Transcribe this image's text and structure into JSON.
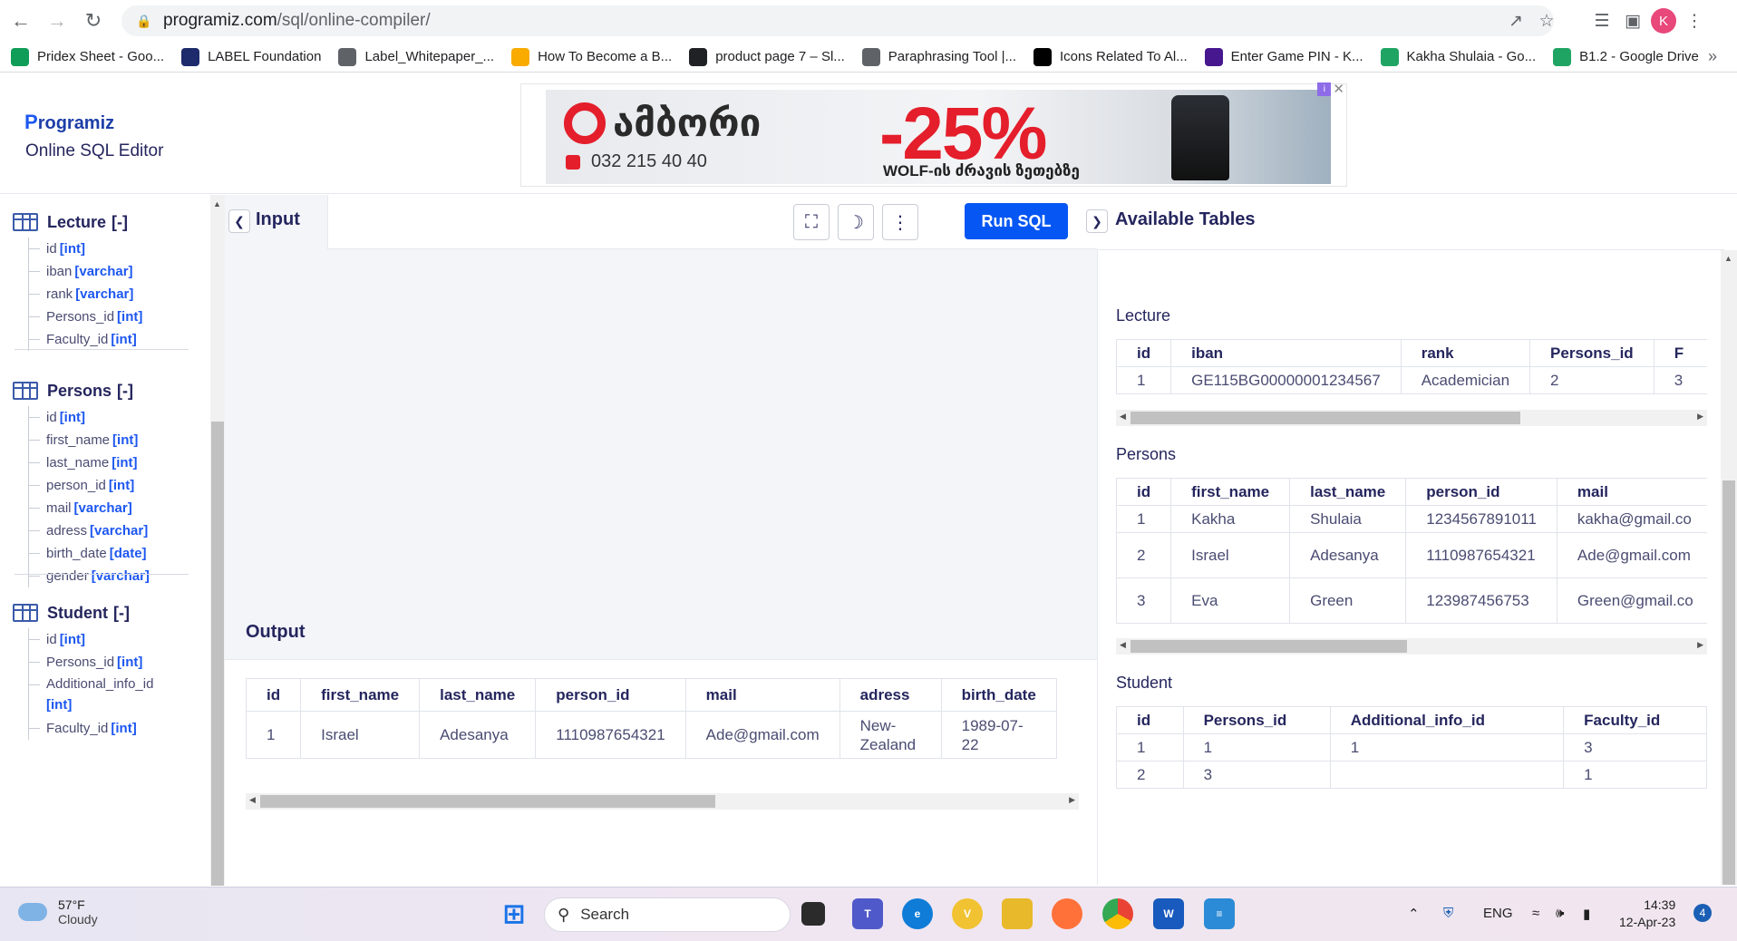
{
  "browser": {
    "url_host": "programiz.com",
    "url_path": "/sql/online-compiler/",
    "profile_initial": "K"
  },
  "bookmarks": [
    {
      "label": "Pridex Sheet - Goo...",
      "icon": "sheets-icon",
      "color": "#0f9d58"
    },
    {
      "label": "LABEL Foundation",
      "icon": "label-icon",
      "color": "#1d2a6b"
    },
    {
      "label": "Label_Whitepaper_...",
      "icon": "globe-icon",
      "color": "#5f6368"
    },
    {
      "label": "How To Become a B...",
      "icon": "bar-icon",
      "color": "#f9ab00"
    },
    {
      "label": "product page 7 – Sl...",
      "icon": "s-icon",
      "color": "#202124"
    },
    {
      "label": "Paraphrasing Tool |...",
      "icon": "pen-icon",
      "color": "#5f6368"
    },
    {
      "label": "Icons Related To Al...",
      "icon": "dots-icon",
      "color": "#000000"
    },
    {
      "label": "Enter Game PIN - K...",
      "icon": "kahoot-icon",
      "color": "#46178f"
    },
    {
      "label": "Kakha Shulaia - Go...",
      "icon": "drive-icon",
      "color": "#1fa463"
    },
    {
      "label": "B1.2 - Google Drive",
      "icon": "drive-icon",
      "color": "#1fa463"
    }
  ],
  "header": {
    "logo": "rogramiz",
    "logo_p": "P",
    "subtitle": "Online SQL Editor"
  },
  "ad": {
    "brand": "ამბორი",
    "phone": "032 215 40 40",
    "discount": "-25%",
    "tagline": "WOLF-ის ძრავის ზეთებზე"
  },
  "sidebar": {
    "tables": [
      {
        "name": "Lecture",
        "toggle": "[-]",
        "columns": [
          {
            "name": "id",
            "type": "[int]"
          },
          {
            "name": "iban",
            "type": "[varchar]"
          },
          {
            "name": "rank",
            "type": "[varchar]"
          },
          {
            "name": "Persons_id",
            "type": "[int]"
          },
          {
            "name": "Faculty_id",
            "type": "[int]"
          }
        ]
      },
      {
        "name": "Persons",
        "toggle": "[-]",
        "columns": [
          {
            "name": "id",
            "type": "[int]"
          },
          {
            "name": "first_name",
            "type": "[int]"
          },
          {
            "name": "last_name",
            "type": "[int]"
          },
          {
            "name": "person_id",
            "type": "[int]"
          },
          {
            "name": "mail",
            "type": "[varchar]"
          },
          {
            "name": "adress",
            "type": "[varchar]"
          },
          {
            "name": "birth_date",
            "type": "[date]"
          },
          {
            "name": "gender",
            "type": "[varchar]"
          }
        ]
      },
      {
        "name": "Student",
        "toggle": "[-]",
        "columns": [
          {
            "name": "id",
            "type": "[int]"
          },
          {
            "name": "Persons_id",
            "type": "[int]"
          },
          {
            "name": "Additional_info_id",
            "type": "[int]"
          },
          {
            "name": "Faculty_id",
            "type": "[int]"
          }
        ]
      }
    ]
  },
  "editor": {
    "tab_label": "Input",
    "run_label": "Run SQL"
  },
  "output": {
    "label": "Output",
    "headers": [
      "id",
      "first_name",
      "last_name",
      "person_id",
      "mail",
      "adress",
      "birth_date"
    ],
    "rows": [
      [
        "1",
        "Israel",
        "Adesanya",
        "1110987654321",
        "Ade@gmail.com",
        "New-\nZealand",
        "1989-07-\n22"
      ]
    ]
  },
  "available": {
    "title": "Available Tables",
    "tables": [
      {
        "name": "Lecture",
        "headers": [
          "id",
          "iban",
          "rank",
          "Persons_id",
          "F"
        ],
        "rows": [
          [
            "1",
            "GE115BG00000001234567",
            "Academician",
            "2",
            "3"
          ]
        ]
      },
      {
        "name": "Persons",
        "headers": [
          "id",
          "first_name",
          "last_name",
          "person_id",
          "mail"
        ],
        "rows": [
          [
            "1",
            "Kakha",
            "Shulaia",
            "1234567891011",
            "kakha@gmail.co"
          ],
          [
            "2",
            "Israel",
            "Adesanya",
            "1110987654321",
            "Ade@gmail.com"
          ],
          [
            "3",
            "Eva",
            "Green",
            "123987456753",
            "Green@gmail.co"
          ]
        ]
      },
      {
        "name": "Student",
        "headers": [
          "id",
          "Persons_id",
          "Additional_info_id",
          "Faculty_id"
        ],
        "rows": [
          [
            "1",
            "1",
            "1",
            "3"
          ],
          [
            "2",
            "3",
            "",
            "1"
          ]
        ]
      }
    ]
  },
  "taskbar": {
    "temp": "57°F",
    "condition": "Cloudy",
    "search": "Search",
    "lang": "ENG",
    "time": "14:39",
    "date": "12-Apr-23",
    "notifications": "4"
  }
}
